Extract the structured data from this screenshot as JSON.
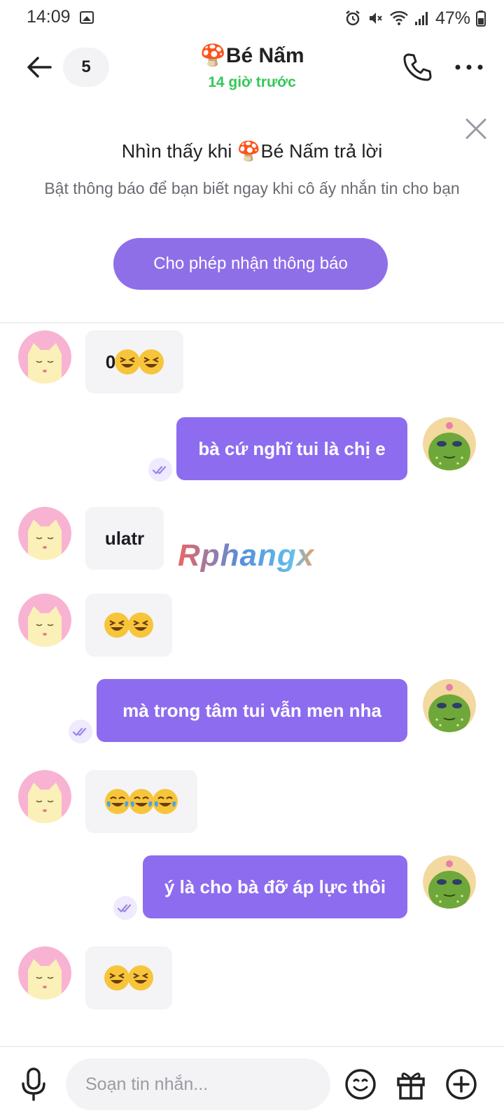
{
  "status_bar": {
    "time": "14:09",
    "battery": "47%"
  },
  "header": {
    "unread_count": "5",
    "contact_name": "🍄Bé Nấm",
    "last_seen": "14 giờ trước"
  },
  "notification": {
    "title": "Nhìn thấy khi 🍄Bé Nấm trả lời",
    "description": "Bật thông báo để bạn biết ngay khi cô ấy nhắn tin cho bạn",
    "button_label": "Cho phép nhận thông báo"
  },
  "messages": [
    {
      "side": "in",
      "text": "0"
    },
    {
      "side": "out",
      "text": "bà cứ nghĩ tui là chị e"
    },
    {
      "side": "in",
      "text": "ulatr"
    },
    {
      "side": "in",
      "text": ""
    },
    {
      "side": "out",
      "text": "mà trong tâm tui vẫn men nha"
    },
    {
      "side": "in",
      "text": ""
    },
    {
      "side": "out",
      "text": "ý là cho bà đỡ áp lực thôi"
    },
    {
      "side": "in",
      "text": ""
    }
  ],
  "watermark": "Rphangx",
  "composer": {
    "placeholder": "Soạn tin nhắn..."
  },
  "colors": {
    "accent": "#8d6cef",
    "online": "#34c759",
    "incoming_bubble": "#f4f4f6"
  }
}
